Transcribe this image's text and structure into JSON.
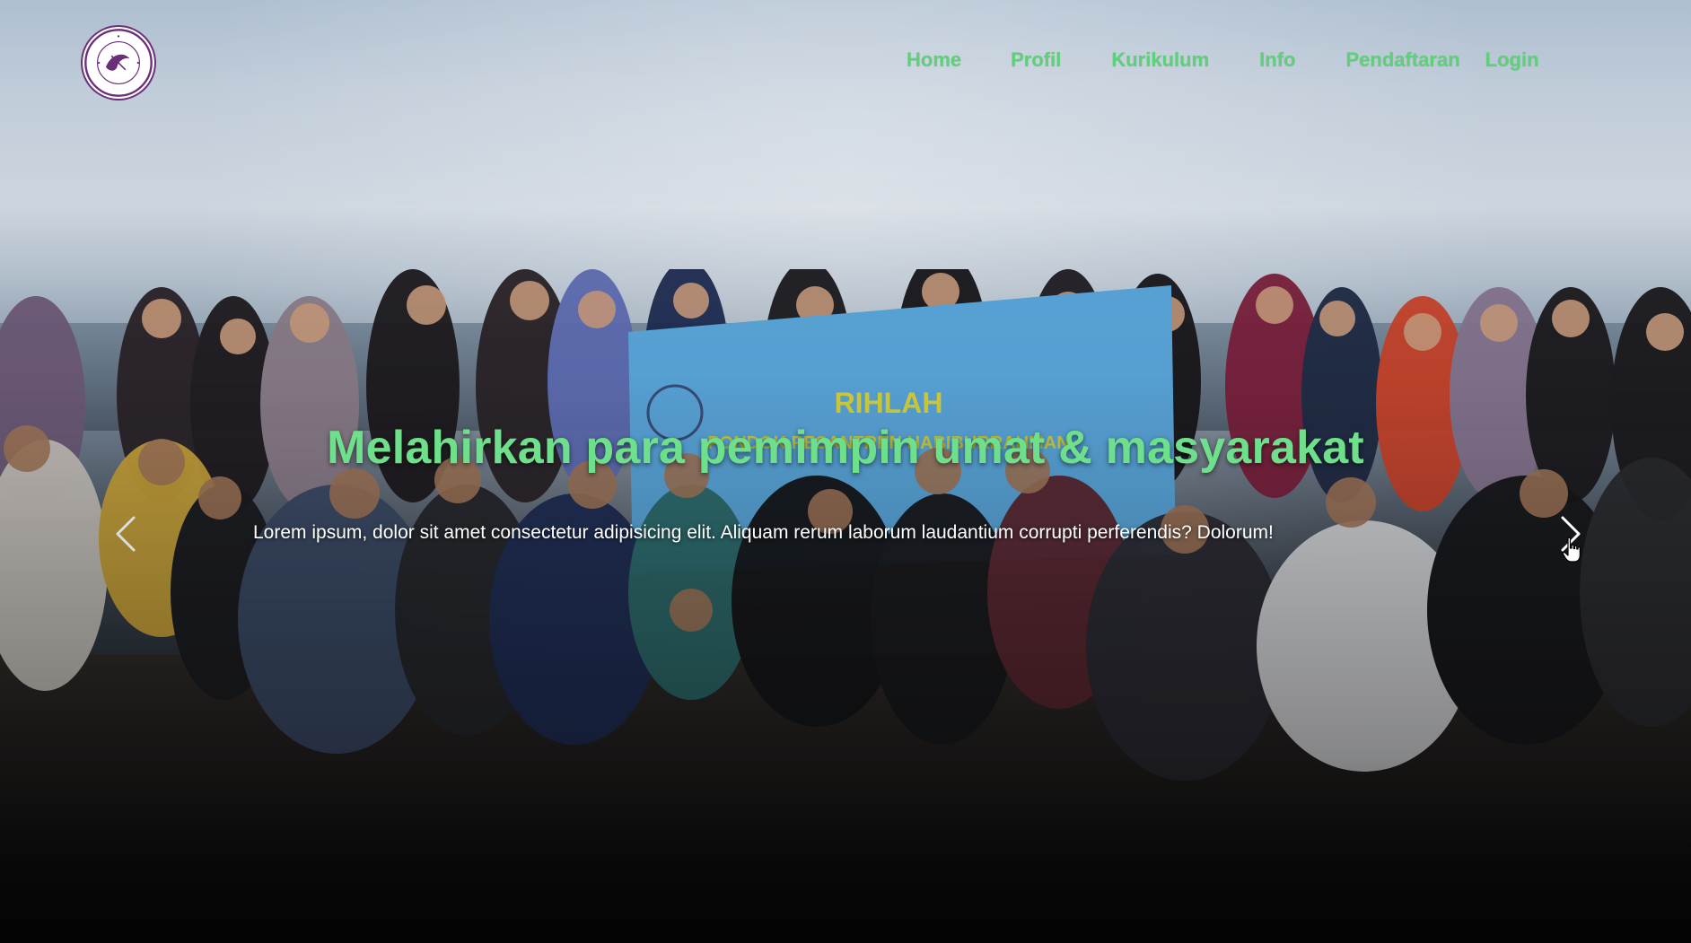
{
  "header": {
    "logo_text": "PONDOK PESANTREN HABIBURRAHMAN KAREES BANYURESMI GARUT",
    "nav": [
      {
        "label": "Home"
      },
      {
        "label": "Profil"
      },
      {
        "label": "Kurikulum"
      },
      {
        "label": "Info"
      },
      {
        "label": "Pendaftaran"
      },
      {
        "label": "Login"
      }
    ]
  },
  "hero": {
    "banner_text": "RIHLAH",
    "banner_sub": "PONDOK PESANTREN HABIBURRAHMAN",
    "title": "Melahirkan para pemimpin umat & masyarakat",
    "text": "Lorem ipsum, dolor sit amet consectetur adipisicing elit. Aliquam rerum laborum laudantium corrupti perferendis? Dolorum!"
  },
  "colors": {
    "accent_green": "#5fd07a",
    "title_green": "#6ee08c",
    "banner_blue": "#5aa7dc",
    "logo_purple": "#6b2f7a"
  },
  "icons": {
    "prev": "chevron-left-icon",
    "next": "chevron-right-icon",
    "cursor": "hand-pointer-icon"
  }
}
